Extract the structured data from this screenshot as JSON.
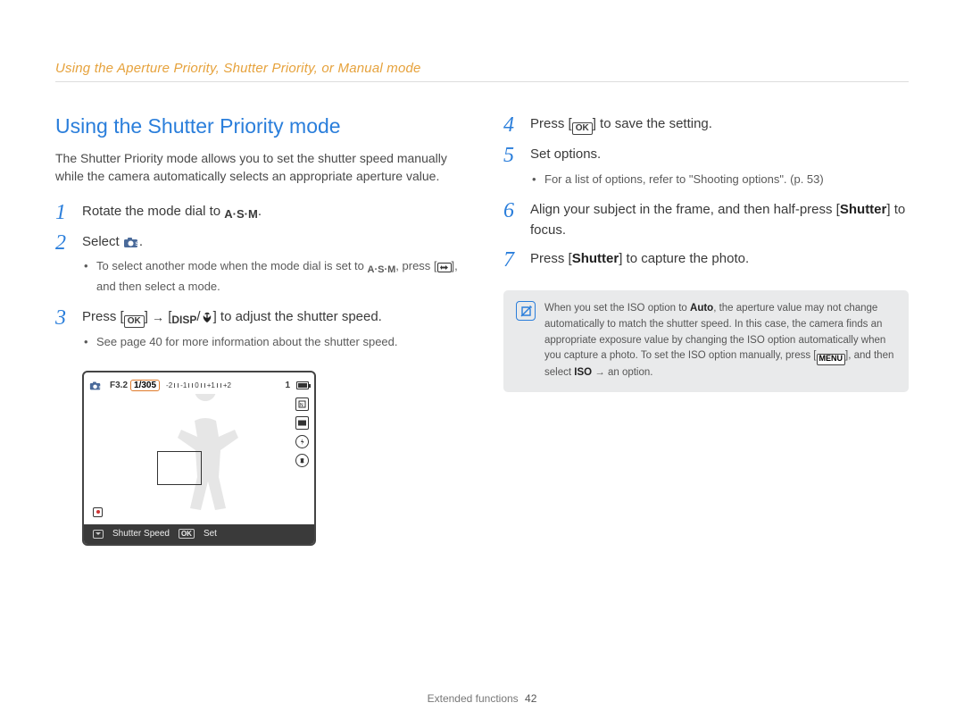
{
  "header": {
    "chapter_title": "Using the Aperture Priority, Shutter Priority, or Manual mode"
  },
  "section": {
    "title": "Using the Shutter Priority mode",
    "intro": "The Shutter Priority mode allows you to set the shutter speed manually while the camera automatically selects an appropriate aperture value."
  },
  "icons": {
    "asm": "A·S·M",
    "ok": "OK",
    "disp": "DISP",
    "menu": "MENU"
  },
  "steps_left": [
    {
      "num": "1",
      "text_before": "Rotate the mode dial to ",
      "icon": "asm",
      "text_after": "."
    },
    {
      "num": "2",
      "text_before": "Select ",
      "icon": "cam-s",
      "text_after": ".",
      "sub": [
        {
          "line_before": "To select another mode when the mode dial is set to ",
          "icon1": "asm",
          "mid": ", press [",
          "icon2": "back",
          "after": "], and then select a mode."
        }
      ]
    },
    {
      "num": "3",
      "parts": {
        "a": "Press [",
        "b": "] ",
        "c": " [",
        "d": "/",
        "e": "] to adjust the shutter speed."
      },
      "sub_simple": [
        "See page 40 for more information about the shutter speed."
      ]
    }
  ],
  "lcd": {
    "f_value": "F3.2",
    "shutter": "1/305",
    "ev_labels": [
      "-2",
      "-1",
      "0",
      "+1",
      "+2"
    ],
    "count": "1",
    "footer_label": "Shutter Speed",
    "footer_ok": "OK",
    "footer_set": "Set"
  },
  "steps_right": [
    {
      "num": "4",
      "text_before": "Press [",
      "icon": "ok",
      "text_after": "] to save the setting."
    },
    {
      "num": "5",
      "text": "Set options.",
      "sub_simple": [
        "For a list of options, refer to \"Shooting options\". (p. 53)"
      ]
    },
    {
      "num": "6",
      "rich": {
        "a": "Align your subject in the frame, and then half-press [",
        "b": "Shutter",
        "c": "] to focus."
      }
    },
    {
      "num": "7",
      "rich": {
        "a": "Press [",
        "b": "Shutter",
        "c": "] to capture the photo."
      }
    }
  ],
  "note": {
    "parts": {
      "a": "When you set the ISO option to ",
      "auto": "Auto",
      "b": ", the aperture value may not change automatically to match the shutter speed. In this case, the camera finds an appropriate exposure value by changing the ISO option automatically when you capture a photo. To set the ISO option manually, press [",
      "menu": "MENU",
      "c": "], and then select ",
      "iso": "ISO",
      "d": " → an option."
    }
  },
  "footer": {
    "section": "Extended functions",
    "page": "42"
  }
}
